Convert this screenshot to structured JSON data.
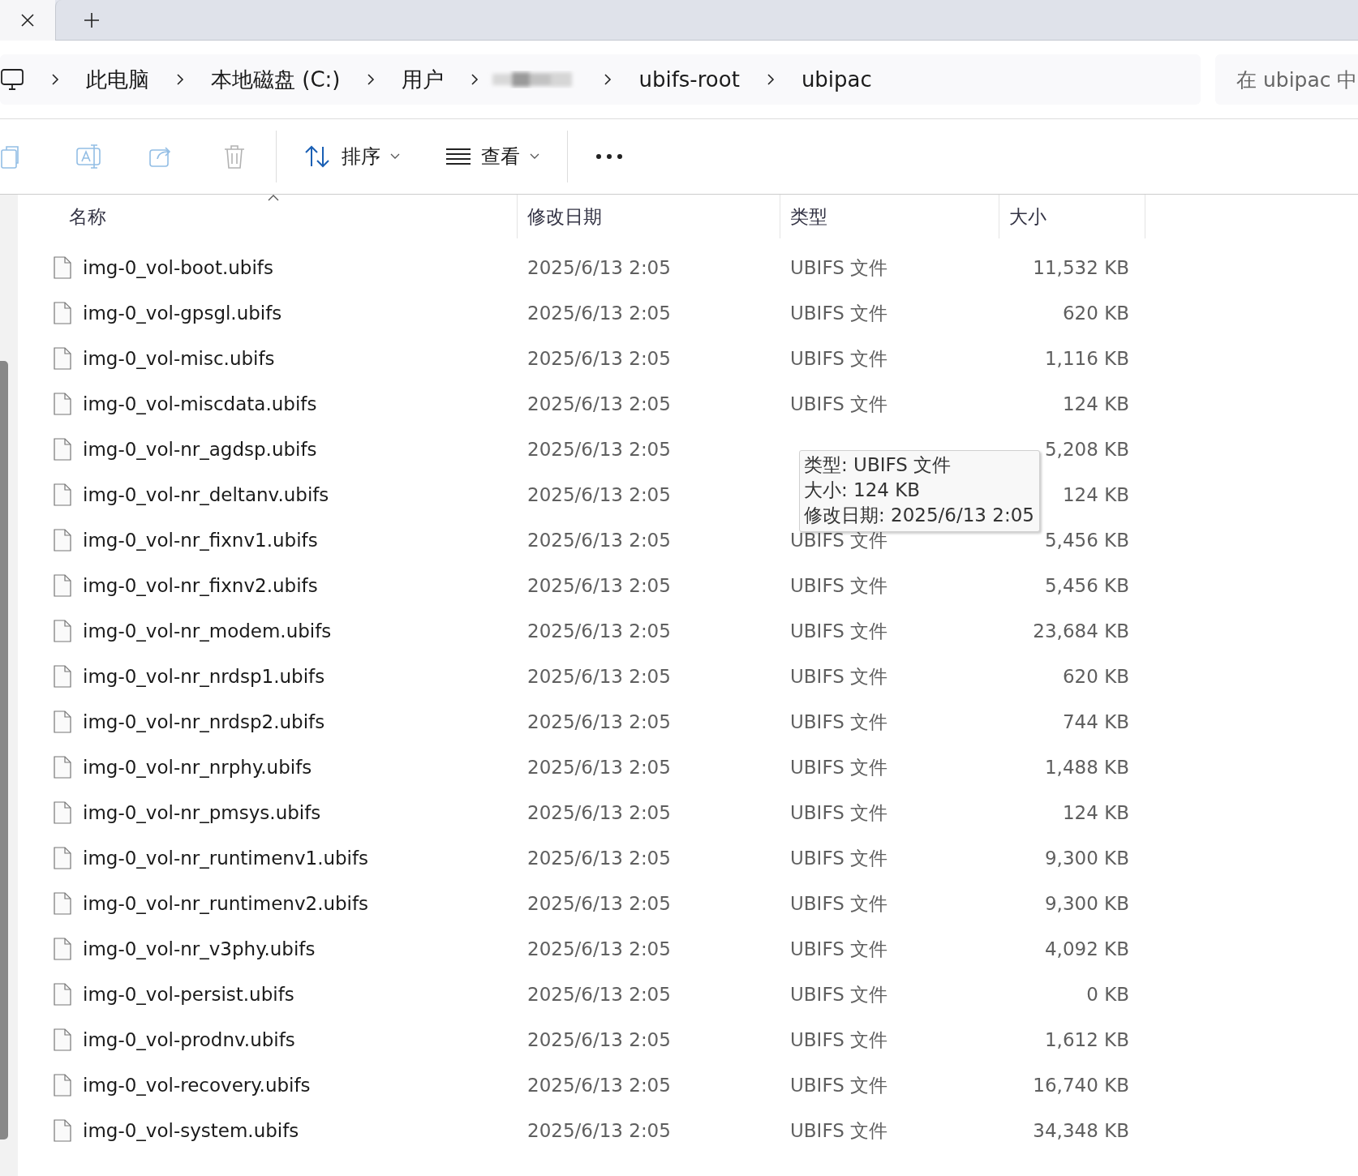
{
  "tab_bar": {
    "tabs": [
      {
        "kind": "close"
      },
      {
        "kind": "new"
      }
    ]
  },
  "address_bar": {
    "breadcrumbs": [
      {
        "kind": "icon"
      },
      {
        "kind": "text",
        "label": "此电脑"
      },
      {
        "kind": "text",
        "label": "本地磁盘 (C:)"
      },
      {
        "kind": "text",
        "label": "用户"
      },
      {
        "kind": "redacted"
      },
      {
        "kind": "text",
        "label": "ubifs-root"
      },
      {
        "kind": "text",
        "label": "ubipac"
      }
    ],
    "search": {
      "placeholder": "在 ubipac 中"
    }
  },
  "toolbar": {
    "items": [
      {
        "kind": "copy",
        "disabled": true
      },
      {
        "kind": "rename",
        "disabled": true
      },
      {
        "kind": "share",
        "disabled": true
      },
      {
        "kind": "delete",
        "disabled": true
      },
      {
        "kind": "separator"
      },
      {
        "kind": "sort",
        "label": "排序"
      },
      {
        "kind": "view",
        "label": "查看"
      },
      {
        "kind": "separator"
      },
      {
        "kind": "more"
      }
    ]
  },
  "table": {
    "columns": [
      {
        "label": "名称",
        "sorted": true
      },
      {
        "label": "修改日期",
        "sorted": false
      },
      {
        "label": "类型",
        "sorted": false
      },
      {
        "label": "大小",
        "sorted": false
      }
    ],
    "rows": [
      {
        "name": "img-0_vol-boot.ubifs",
        "date": "2025/6/13 2:05",
        "type": "UBIFS 文件",
        "size": "11,532 KB"
      },
      {
        "name": "img-0_vol-gpsgl.ubifs",
        "date": "2025/6/13 2:05",
        "type": "UBIFS 文件",
        "size": "620 KB"
      },
      {
        "name": "img-0_vol-misc.ubifs",
        "date": "2025/6/13 2:05",
        "type": "UBIFS 文件",
        "size": "1,116 KB"
      },
      {
        "name": "img-0_vol-miscdata.ubifs",
        "date": "2025/6/13 2:05",
        "type": "UBIFS 文件",
        "size": "124 KB"
      },
      {
        "name": "img-0_vol-nr_agdsp.ubifs",
        "date": "2025/6/13 2:05",
        "size": "5,208 KB"
      },
      {
        "name": "img-0_vol-nr_deltanv.ubifs",
        "date": "2025/6/13 2:05",
        "size": "124 KB"
      },
      {
        "name": "img-0_vol-nr_fixnv1.ubifs",
        "date": "2025/6/13 2:05",
        "type": "UBIFS 文件",
        "size": "5,456 KB"
      },
      {
        "name": "img-0_vol-nr_fixnv2.ubifs",
        "date": "2025/6/13 2:05",
        "type": "UBIFS 文件",
        "size": "5,456 KB"
      },
      {
        "name": "img-0_vol-nr_modem.ubifs",
        "date": "2025/6/13 2:05",
        "type": "UBIFS 文件",
        "size": "23,684 KB"
      },
      {
        "name": "img-0_vol-nr_nrdsp1.ubifs",
        "date": "2025/6/13 2:05",
        "type": "UBIFS 文件",
        "size": "620 KB"
      },
      {
        "name": "img-0_vol-nr_nrdsp2.ubifs",
        "date": "2025/6/13 2:05",
        "type": "UBIFS 文件",
        "size": "744 KB"
      },
      {
        "name": "img-0_vol-nr_nrphy.ubifs",
        "date": "2025/6/13 2:05",
        "type": "UBIFS 文件",
        "size": "1,488 KB"
      },
      {
        "name": "img-0_vol-nr_pmsys.ubifs",
        "date": "2025/6/13 2:05",
        "type": "UBIFS 文件",
        "size": "124 KB"
      },
      {
        "name": "img-0_vol-nr_runtimenv1.ubifs",
        "date": "2025/6/13 2:05",
        "type": "UBIFS 文件",
        "size": "9,300 KB"
      },
      {
        "name": "img-0_vol-nr_runtimenv2.ubifs",
        "date": "2025/6/13 2:05",
        "type": "UBIFS 文件",
        "size": "9,300 KB"
      },
      {
        "name": "img-0_vol-nr_v3phy.ubifs",
        "date": "2025/6/13 2:05",
        "type": "UBIFS 文件",
        "size": "4,092 KB"
      },
      {
        "name": "img-0_vol-persist.ubifs",
        "date": "2025/6/13 2:05",
        "type": "UBIFS 文件",
        "size": "0 KB"
      },
      {
        "name": "img-0_vol-prodnv.ubifs",
        "date": "2025/6/13 2:05",
        "type": "UBIFS 文件",
        "size": "1,612 KB"
      },
      {
        "name": "img-0_vol-recovery.ubifs",
        "date": "2025/6/13 2:05",
        "type": "UBIFS 文件",
        "size": "16,740 KB"
      },
      {
        "name": "img-0_vol-system.ubifs",
        "date": "2025/6/13 2:05",
        "type": "UBIFS 文件",
        "size": "34,348 KB"
      }
    ]
  },
  "tooltip": {
    "lines": [
      "类型: UBIFS 文件",
      "大小: 124 KB",
      "修改日期: 2025/6/13 2:05"
    ]
  }
}
